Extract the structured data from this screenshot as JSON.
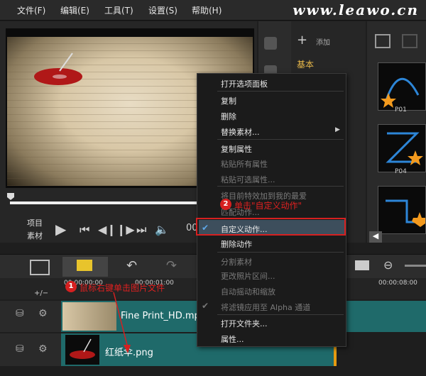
{
  "menubar": {
    "items": [
      "文件(F)",
      "编辑(E)",
      "工具(T)",
      "设置(S)",
      "帮助(H)"
    ],
    "watermark": "www.leawo.cn"
  },
  "preview": {
    "project_label": "项目",
    "clip_label": "素材"
  },
  "library": {
    "add_label": "添加",
    "category": "基本",
    "thumbs": [
      "P01",
      "P04"
    ]
  },
  "timeline": {
    "ruler": [
      "00:00:00:00",
      "00:00:01:00",
      "00:00:08:00"
    ],
    "track1_clip": "Fine Print_HD.mp4",
    "track2_clip": "红纸伞.png",
    "zoom_label": "+/−"
  },
  "context_menu": {
    "items": [
      {
        "label": "打开选项面板",
        "enabled": true
      },
      {
        "label": "复制",
        "enabled": true
      },
      {
        "label": "删除",
        "enabled": true
      },
      {
        "label": "替换素材...",
        "enabled": true,
        "submenu": true
      },
      {
        "label": "复制属性",
        "enabled": true
      },
      {
        "label": "粘贴所有属性",
        "enabled": false
      },
      {
        "label": "粘贴可选属性...",
        "enabled": false
      },
      {
        "label": "将目前特效加到我的最爱",
        "enabled": false
      },
      {
        "label": "匹配动作...",
        "enabled": false
      },
      {
        "label": "自定义动作...",
        "enabled": true,
        "checked": true,
        "highlighted": true
      },
      {
        "label": "删除动作",
        "enabled": true
      },
      {
        "label": "分割素材",
        "enabled": false
      },
      {
        "label": "更改照片区间...",
        "enabled": false
      },
      {
        "label": "自动摇动和缩放",
        "enabled": false
      },
      {
        "label": "将滤镜应用至 Alpha 通道",
        "enabled": false,
        "checked": true
      },
      {
        "label": "打开文件夹...",
        "enabled": true
      },
      {
        "label": "属性...",
        "enabled": true
      }
    ]
  },
  "annotations": {
    "step1_num": "1",
    "step1_text": "鼠标右键单击图片文件",
    "step2_num": "2",
    "step2_text": "单击\"自定义动作\""
  },
  "colors": {
    "highlight_box": "#d62020",
    "clip_track": "#1f6a6a",
    "accent_orange": "#e59b12"
  }
}
